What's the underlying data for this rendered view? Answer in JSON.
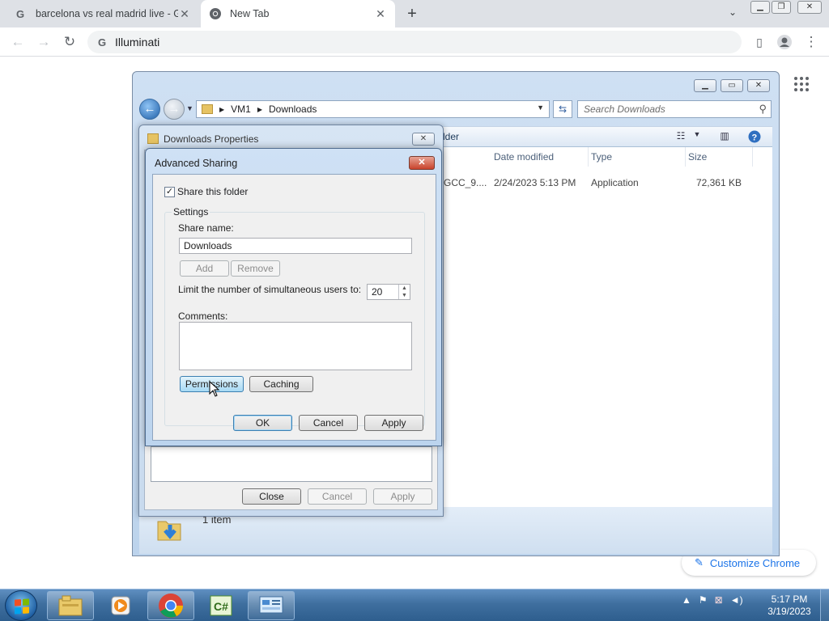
{
  "browser": {
    "tabs": [
      {
        "title": "barcelona vs real madrid live - Go",
        "active": false
      },
      {
        "title": "New Tab",
        "active": true
      }
    ],
    "address": "Illuminati",
    "customize_label": "Customize Chrome"
  },
  "explorer": {
    "breadcrumb": [
      "VM1",
      "Downloads"
    ],
    "search_placeholder": "Search Downloads",
    "new_folder_partial": "lder",
    "columns": [
      "Date modified",
      "Type",
      "Size"
    ],
    "file": {
      "name_partial": "GCC_9....",
      "date_modified": "2/24/2023 5:13 PM",
      "type": "Application",
      "size": "72,361 KB"
    },
    "status_items": "1 item"
  },
  "properties": {
    "title": "Downloads Properties",
    "close_label": "Close",
    "cancel_label": "Cancel",
    "apply_label": "Apply"
  },
  "advanced_sharing": {
    "title": "Advanced Sharing",
    "share_folder_label": "Share this folder",
    "share_folder_checked": true,
    "settings_label": "Settings",
    "share_name_label": "Share name:",
    "share_name_value": "Downloads",
    "add_label": "Add",
    "remove_label": "Remove",
    "limit_label": "Limit the number of simultaneous users to:",
    "limit_value": "20",
    "comments_label": "Comments:",
    "comments_value": "",
    "permissions_label": "Permissions",
    "caching_label": "Caching",
    "ok_label": "OK",
    "cancel_label": "Cancel",
    "apply_label": "Apply"
  },
  "taskbar": {
    "time": "5:17 PM",
    "date": "3/19/2023",
    "pinned": [
      "file-explorer-icon",
      "media-player-icon",
      "chrome-icon",
      "csharp-icon",
      "control-panel-icon"
    ]
  },
  "colors": {
    "accent_blue": "#1a73e8",
    "close_red": "#c9432c",
    "taskbar": "#3f6f9f"
  }
}
